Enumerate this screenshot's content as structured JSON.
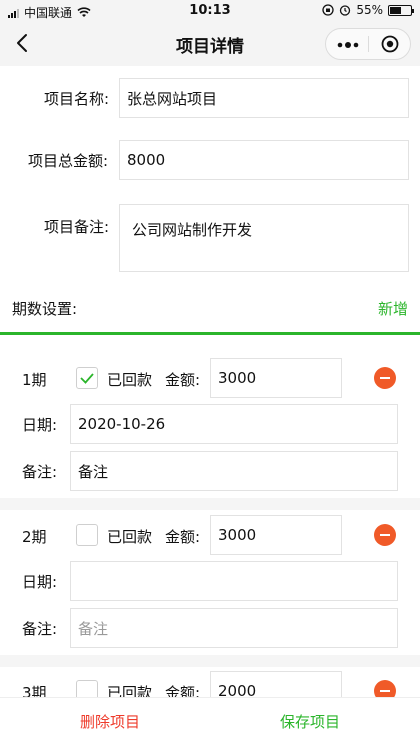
{
  "status_bar": {
    "carrier": "中国联通",
    "time": "10:13",
    "battery_percent": "55%",
    "battery_level": 0.55
  },
  "nav": {
    "title": "项目详情"
  },
  "project": {
    "name_label": "项目名称:",
    "name_value": "张总网站项目",
    "total_label": "项目总金额:",
    "total_value": "8000",
    "note_label": "项目备注:",
    "note_value": "公司网站制作开发"
  },
  "periods_section": {
    "title": "期数设置:",
    "add_label": "新增"
  },
  "periods": [
    {
      "label": "1期",
      "returned_label": "已回款",
      "returned_checked": true,
      "amount_label": "金额:",
      "amount_value": "3000",
      "date_label": "日期:",
      "date_value": "2020-10-26",
      "remark_label": "备注:",
      "remark_value": "备注"
    },
    {
      "label": "2期",
      "returned_label": "已回款",
      "returned_checked": false,
      "amount_label": "金额:",
      "amount_value": "3000",
      "date_label": "日期:",
      "date_value": "",
      "remark_label": "备注:",
      "remark_placeholder": "备注"
    },
    {
      "label": "3期",
      "returned_label": "已回款",
      "returned_checked": false,
      "amount_label": "金额:",
      "amount_value": "2000"
    }
  ],
  "bottom_bar": {
    "delete_label": "删除项目",
    "save_label": "保存项目"
  },
  "colors": {
    "accent_green": "#2bb52b",
    "danger_red": "#ee3b2b",
    "minus_orange": "#f05a28"
  },
  "icons": [
    "back-chevron-icon",
    "more-dots-icon",
    "target-icon",
    "check-icon",
    "minus-circle-icon",
    "wifi-icon",
    "battery-icon"
  ]
}
